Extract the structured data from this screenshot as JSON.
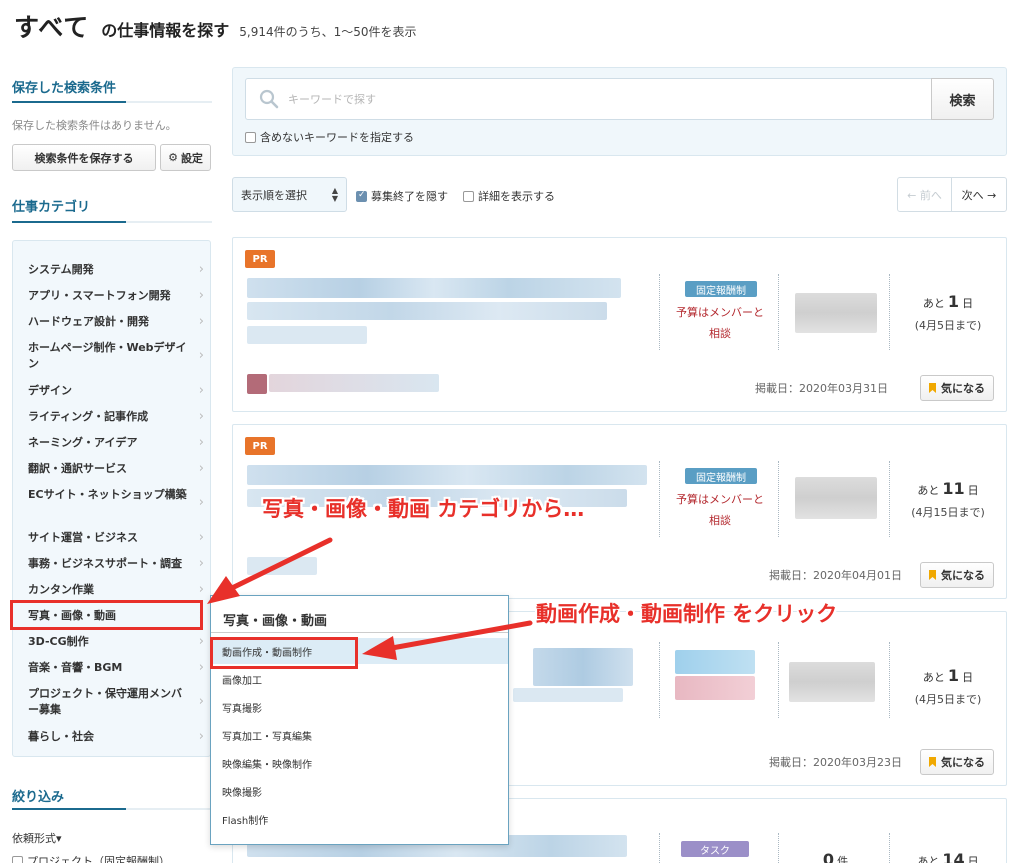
{
  "header": {
    "title": "すべて",
    "subtitle": "の仕事情報を探す",
    "count_text": "5,914件のうち、1〜50件を表示"
  },
  "sidebar": {
    "saved_title": "保存した検索条件",
    "saved_empty": "保存した検索条件はありません。",
    "save_button": "検索条件を保存する",
    "settings_button": "設定",
    "category_title": "仕事カテゴリ",
    "categories": [
      "システム開発",
      "アプリ・スマートフォン開発",
      "ハードウェア設計・開発",
      "ホームページ制作・Webデザイン",
      "デザイン",
      "ライティング・記事作成",
      "ネーミング・アイデア",
      "翻訳・通訳サービス",
      "ECサイト・ネットショップ構築",
      "サイト運営・ビジネス",
      "事務・ビジネスサポート・調査",
      "カンタン作業",
      "写真・画像・動画",
      "3D-CG制作",
      "音楽・音響・BGM",
      "プロジェクト・保守運用メンバー募集",
      "暮らし・社会"
    ],
    "filter_title": "絞り込み",
    "filter_type": "依頼形式",
    "filter_option": "プロジェクト（固定報酬制）"
  },
  "search": {
    "placeholder": "キーワードで探す",
    "button": "検索",
    "exclude_label": "含めないキーワードを指定する"
  },
  "toolbar": {
    "sort_label": "表示順を選択",
    "hide_closed": "募集終了を隠す",
    "show_details": "詳細を表示する",
    "prev": "← 前へ",
    "next": "次へ →"
  },
  "jobs": [
    {
      "pr": "PR",
      "type": "固定報酬制",
      "budget1": "予算はメンバーと",
      "budget2": "相談",
      "days_prefix": "あと",
      "days": "1",
      "days_unit": "日",
      "deadline": "(4月5日まで)",
      "posted": "掲載日：2020年03月31日",
      "fav": "気になる"
    },
    {
      "pr": "PR",
      "type": "固定報酬制",
      "budget1": "予算はメンバーと",
      "budget2": "相談",
      "days_prefix": "あと",
      "days": "11",
      "days_unit": "日",
      "deadline": "(4月15日まで)",
      "posted": "掲載日：2020年04月01日",
      "fav": "気になる"
    },
    {
      "days_prefix": "あと",
      "days": "1",
      "days_unit": "日",
      "deadline": "(4月5日まで)",
      "posted": "掲載日：2020年03月23日",
      "fav": "気になる"
    },
    {
      "type": "タスク",
      "count": "0",
      "count_unit": "件",
      "days_prefix": "あと",
      "days": "14",
      "days_unit": "日"
    }
  ],
  "dropdown": {
    "title": "写真・画像・動画",
    "items": [
      "動画作成・動画制作",
      "画像加工",
      "写真撮影",
      "写真加工・写真編集",
      "映像編集・映像制作",
      "映像撮影",
      "Flash制作"
    ]
  },
  "annotations": {
    "text1": "写真・画像・動画 カテゴリから…",
    "text2": "動画作成・動画制作 をクリック"
  },
  "colors": {
    "accent": "#1b6a8e",
    "pr_badge": "#e8742a",
    "fixed_badge": "#5a9ec4",
    "task_badge": "#9b8fc8",
    "annotation_red": "#e8302a"
  }
}
